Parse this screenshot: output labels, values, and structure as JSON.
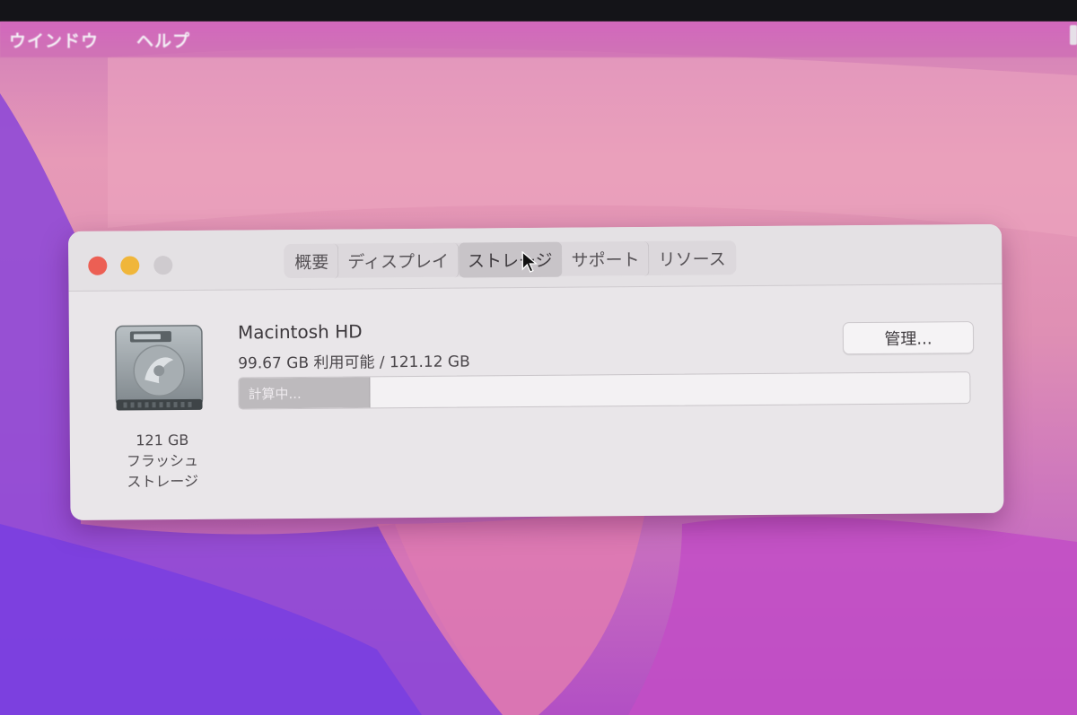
{
  "menubar": {
    "items": [
      {
        "label": "ウインドウ"
      },
      {
        "label": "ヘルプ"
      }
    ]
  },
  "window": {
    "tabs": [
      {
        "label": "概要",
        "active": false
      },
      {
        "label": "ディスプレイ",
        "active": false
      },
      {
        "label": "ストレージ",
        "active": true
      },
      {
        "label": "サポート",
        "active": false
      },
      {
        "label": "リソース",
        "active": false
      }
    ],
    "disk": {
      "icon": "hard-drive-icon",
      "capacity_label": "121 GB",
      "type_line1": "フラッシュ",
      "type_line2": "ストレージ"
    },
    "volume": {
      "name": "Macintosh HD",
      "usage": "99.67 GB 利用可能 / 121.12 GB",
      "manage_label": "管理...",
      "bar_label": "計算中...",
      "bar_fill_fraction": 0.178
    }
  },
  "colors": {
    "close": "#ec5f54",
    "minimize": "#f0b63a",
    "maximize_disabled": "#cfcbcf",
    "window_bg": "#e9e6e9"
  }
}
